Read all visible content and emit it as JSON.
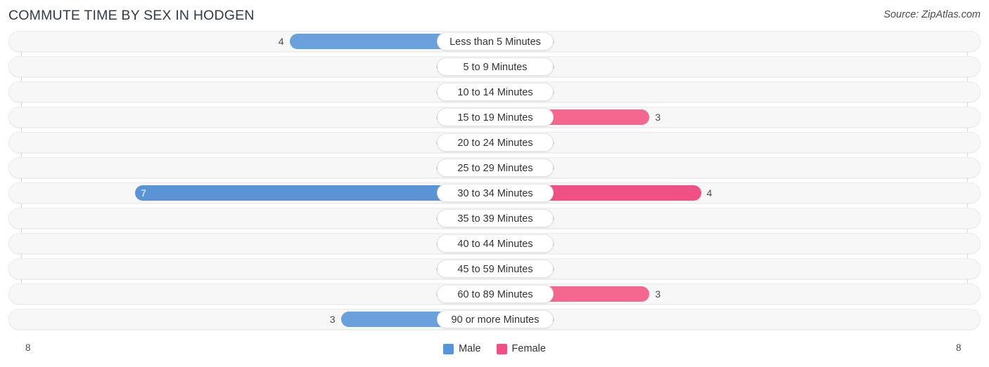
{
  "header": {
    "title": "COMMUTE TIME BY SEX IN HODGEN",
    "source": "Source: ZipAtlas.com"
  },
  "legend": {
    "items": [
      {
        "label": "Male",
        "color": "#5b94d6"
      },
      {
        "label": "Female",
        "color": "#f05185"
      }
    ]
  },
  "axis": {
    "left_tick": "8",
    "right_tick": "8"
  },
  "chart_data": {
    "type": "bar",
    "subtype": "diverging-bidirectional",
    "title": "COMMUTE TIME BY SEX IN HODGEN",
    "source": "Source: ZipAtlas.com",
    "xlabel": "",
    "ylabel": "",
    "xlim": [
      8,
      8
    ],
    "axis_max": 8,
    "grid": false,
    "legend_position": "bottom-center",
    "categories": [
      "Less than 5 Minutes",
      "5 to 9 Minutes",
      "10 to 14 Minutes",
      "15 to 19 Minutes",
      "20 to 24 Minutes",
      "25 to 29 Minutes",
      "30 to 34 Minutes",
      "35 to 39 Minutes",
      "40 to 44 Minutes",
      "45 to 59 Minutes",
      "60 to 89 Minutes",
      "90 or more Minutes"
    ],
    "series": [
      {
        "name": "Male",
        "color": "#5b94d6",
        "direction": "left",
        "values": [
          4,
          0,
          0,
          0,
          0,
          0,
          7,
          0,
          0,
          0,
          0,
          3
        ]
      },
      {
        "name": "Female",
        "color": "#f05185",
        "direction": "right",
        "values": [
          0,
          0,
          0,
          3,
          0,
          0,
          4,
          0,
          0,
          0,
          3,
          0
        ]
      }
    ]
  },
  "rows": [
    {
      "category": "Less than 5 Minutes",
      "male": "4",
      "female": "0"
    },
    {
      "category": "5 to 9 Minutes",
      "male": "0",
      "female": "0"
    },
    {
      "category": "10 to 14 Minutes",
      "male": "0",
      "female": "0"
    },
    {
      "category": "15 to 19 Minutes",
      "male": "0",
      "female": "3"
    },
    {
      "category": "20 to 24 Minutes",
      "male": "0",
      "female": "0"
    },
    {
      "category": "25 to 29 Minutes",
      "male": "0",
      "female": "0"
    },
    {
      "category": "30 to 34 Minutes",
      "male": "7",
      "female": "4"
    },
    {
      "category": "35 to 39 Minutes",
      "male": "0",
      "female": "0"
    },
    {
      "category": "40 to 44 Minutes",
      "male": "0",
      "female": "0"
    },
    {
      "category": "45 to 59 Minutes",
      "male": "0",
      "female": "0"
    },
    {
      "category": "60 to 89 Minutes",
      "male": "0",
      "female": "3"
    },
    {
      "category": "90 or more Minutes",
      "male": "3",
      "female": "0"
    }
  ]
}
